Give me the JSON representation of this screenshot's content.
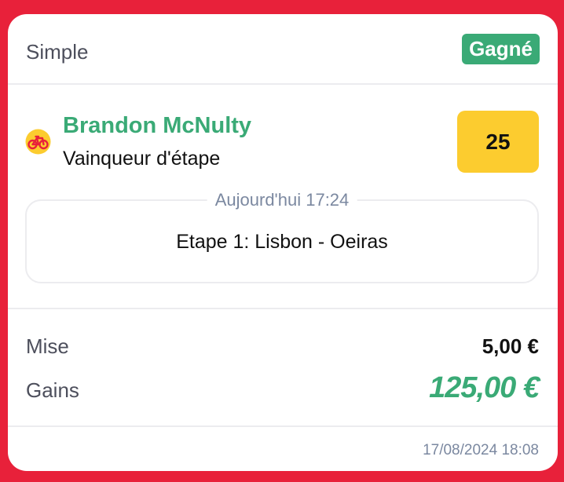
{
  "header": {
    "bet_type": "Simple",
    "status": "Gagné"
  },
  "selection": {
    "sport_icon": "cycling-icon",
    "rider": "Brandon McNulty",
    "market": "Vainqueur d'étape",
    "odds": "25"
  },
  "event": {
    "date": "Aujourd'hui 17:24",
    "name": "Etape 1: Lisbon - Oeiras"
  },
  "amounts": {
    "stake_label": "Mise",
    "stake_value": "5,00 €",
    "gains_label": "Gains",
    "gains_value": "125,00 €"
  },
  "footer": {
    "timestamp": "17/08/2024 18:08"
  },
  "colors": {
    "background": "#E8213A",
    "win_green": "#3aaa76",
    "odds_yellow": "#fccc2f"
  }
}
